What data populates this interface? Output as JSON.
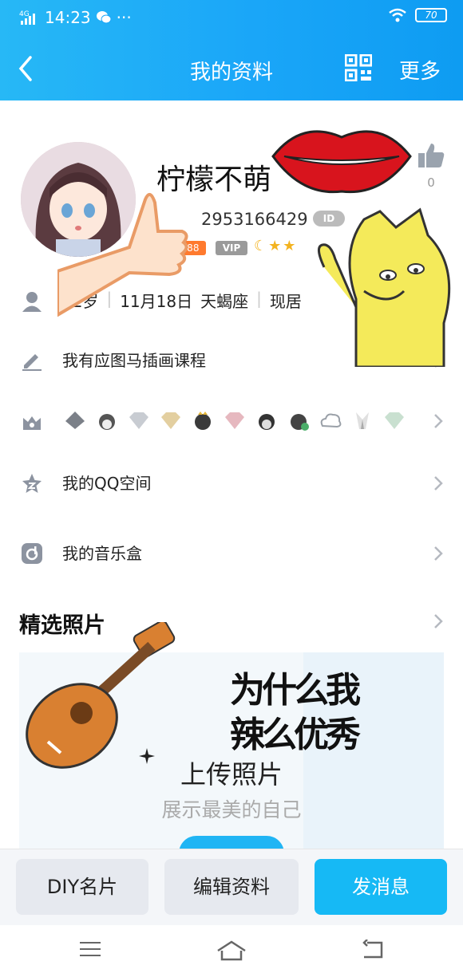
{
  "status_bar": {
    "network": "4G",
    "time": "14:23",
    "extra": "···",
    "battery": "70"
  },
  "nav": {
    "title": "我的资料",
    "more_label": "更多"
  },
  "profile": {
    "nickname": "柠檬不萌",
    "qq_number": "2953166429",
    "id_badge": "ID",
    "level_badge": "888",
    "vip_label": "VIP",
    "like_count": "0"
  },
  "info": {
    "age": "22岁",
    "birthday": "11月18日",
    "zodiac": "天蝎座",
    "location": "现居"
  },
  "rows": {
    "signature": "我有应图马插画课程",
    "qzone": "我的QQ空间",
    "music": "我的音乐盒"
  },
  "photos": {
    "section_title": "精选照片",
    "upload_title": "上传照片",
    "upload_subtitle": "展示最美的自己"
  },
  "sticker_text": "为什么我辣么优秀",
  "bottom_actions": {
    "diy": "DIY名片",
    "edit": "编辑资料",
    "message": "发消息"
  },
  "colors": {
    "header": "#1aa6f8",
    "primary_button": "#16b9f5",
    "badge_orange": "#ff7a2e"
  }
}
